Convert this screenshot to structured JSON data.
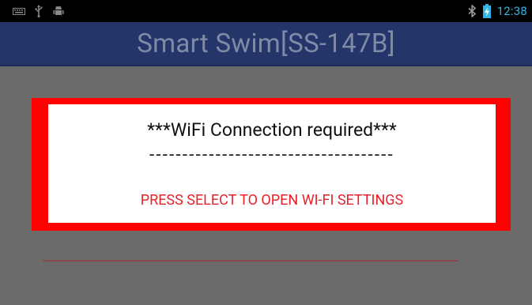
{
  "status_bar": {
    "left_icons": [
      "keyboard-icon",
      "usb-icon",
      "debug-android-icon"
    ],
    "right_icons": [
      "bluetooth-icon",
      "battery-charging-icon"
    ],
    "time": "12:38",
    "accent_color": "#33b5e5"
  },
  "app_bar": {
    "title": "Smart Swim[SS-147B]",
    "background_color": "#233569"
  },
  "dialog": {
    "heading": "***WiFi Connection required***",
    "divider": "-------------------------------------",
    "action_text": "PRESS SELECT TO OPEN WI-FI SETTINGS",
    "frame_color": "#ff0000",
    "action_color": "#e8222a"
  }
}
